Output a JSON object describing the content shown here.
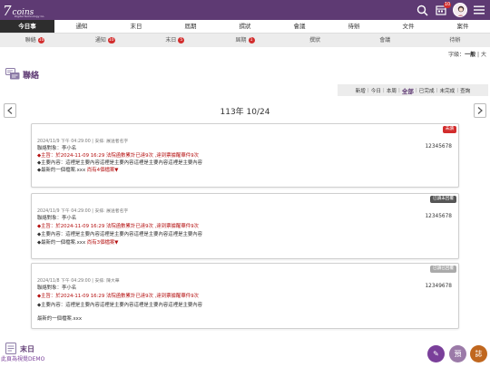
{
  "app": {
    "logo_number": "7",
    "logo_word": "coins",
    "logo_sub": "Digital Technology Co.",
    "notification_count": "10"
  },
  "main_tabs": [
    {
      "label": "今日事"
    },
    {
      "label": "通知"
    },
    {
      "label": "末日"
    },
    {
      "label": "屆期"
    },
    {
      "label": "撰狀"
    },
    {
      "label": "會議"
    },
    {
      "label": "待辦"
    },
    {
      "label": "文件"
    },
    {
      "label": "案件"
    }
  ],
  "sub_tabs": [
    {
      "label": "聯絡",
      "badge": "10"
    },
    {
      "label": "通知",
      "badge": "10"
    },
    {
      "label": "末日",
      "badge": "5"
    },
    {
      "label": "屆期",
      "badge": "1"
    },
    {
      "label": "撰狀",
      "badge": ""
    },
    {
      "label": "會議",
      "badge": ""
    },
    {
      "label": "待辦",
      "badge": ""
    }
  ],
  "font_size": {
    "label": "字級：",
    "normal": "一般",
    "sep": "|",
    "large": "大"
  },
  "section": {
    "title": "聯絡"
  },
  "filters": {
    "items": [
      "新增",
      "今日",
      "本周",
      "全部",
      "已完成",
      "未完成",
      "查詢"
    ],
    "selected": "全部",
    "sep": "|"
  },
  "date_nav": {
    "label": "113年 10/24"
  },
  "cards": [
    {
      "tag": "未讀",
      "meta": "2024/11/9 下午 04:29:00 | 安排: 展送者名字",
      "contact": "聯絡對象：李小名",
      "phone": "12345678",
      "subject": "◆主旨：於2024-11-09 16:29 法院函數累計已達9次 ,達到票據醒華件9次",
      "content": "◆主要內容：這裡是主要內容這裡是主要內容這裡是主要內容這裡是主要內容",
      "file": "◆最新的一個檔案.xxx",
      "more": "尚有4個檔案▼"
    },
    {
      "tag": "已讀未回覆",
      "meta": "2024/11/9 下午 04:29:00 | 安排: 展送者名字",
      "contact": "聯絡對象：李小名",
      "phone": "12345678",
      "subject": "◆主旨：於2024-11-09 16:29 法院函數累計已達9次 ,達到票據醒華件9次",
      "content": "◆主要內容：這裡是主要內容這裡是主要內容這裡是主要內容這裡是主要內容",
      "file": "◆最新的一個檔案.xxx",
      "more": "尚有3個檔案▼"
    },
    {
      "tag": "已讀已回覆",
      "meta": "2024/11/8 下午 04:29:00 | 安排: 陳大華",
      "contact": "聯絡對象：李小名",
      "phone": "12349678",
      "subject": "◆主旨：於2024-11-09 16:29 法院函數累計已達9次 ,達到票據醒華件9次",
      "content": "◆主要內容：這裡是主要內容這裡是主要內容這裡是主要內容這裡是主要內容",
      "file": "最新的一個檔案.xxx",
      "more": ""
    }
  ],
  "bottom_section": {
    "title": "末日"
  },
  "demo_label": "此頁為視覺DEMO",
  "fabs": [
    {
      "label": "✎",
      "color": "#7a3f9a"
    },
    {
      "label": "預",
      "color": "#9b7aa8"
    },
    {
      "label": "誌",
      "color": "#c0671f"
    }
  ],
  "colors": {
    "brand": "#5e3a73",
    "alert": "#d22d2d",
    "text_red": "#b40e0e"
  }
}
